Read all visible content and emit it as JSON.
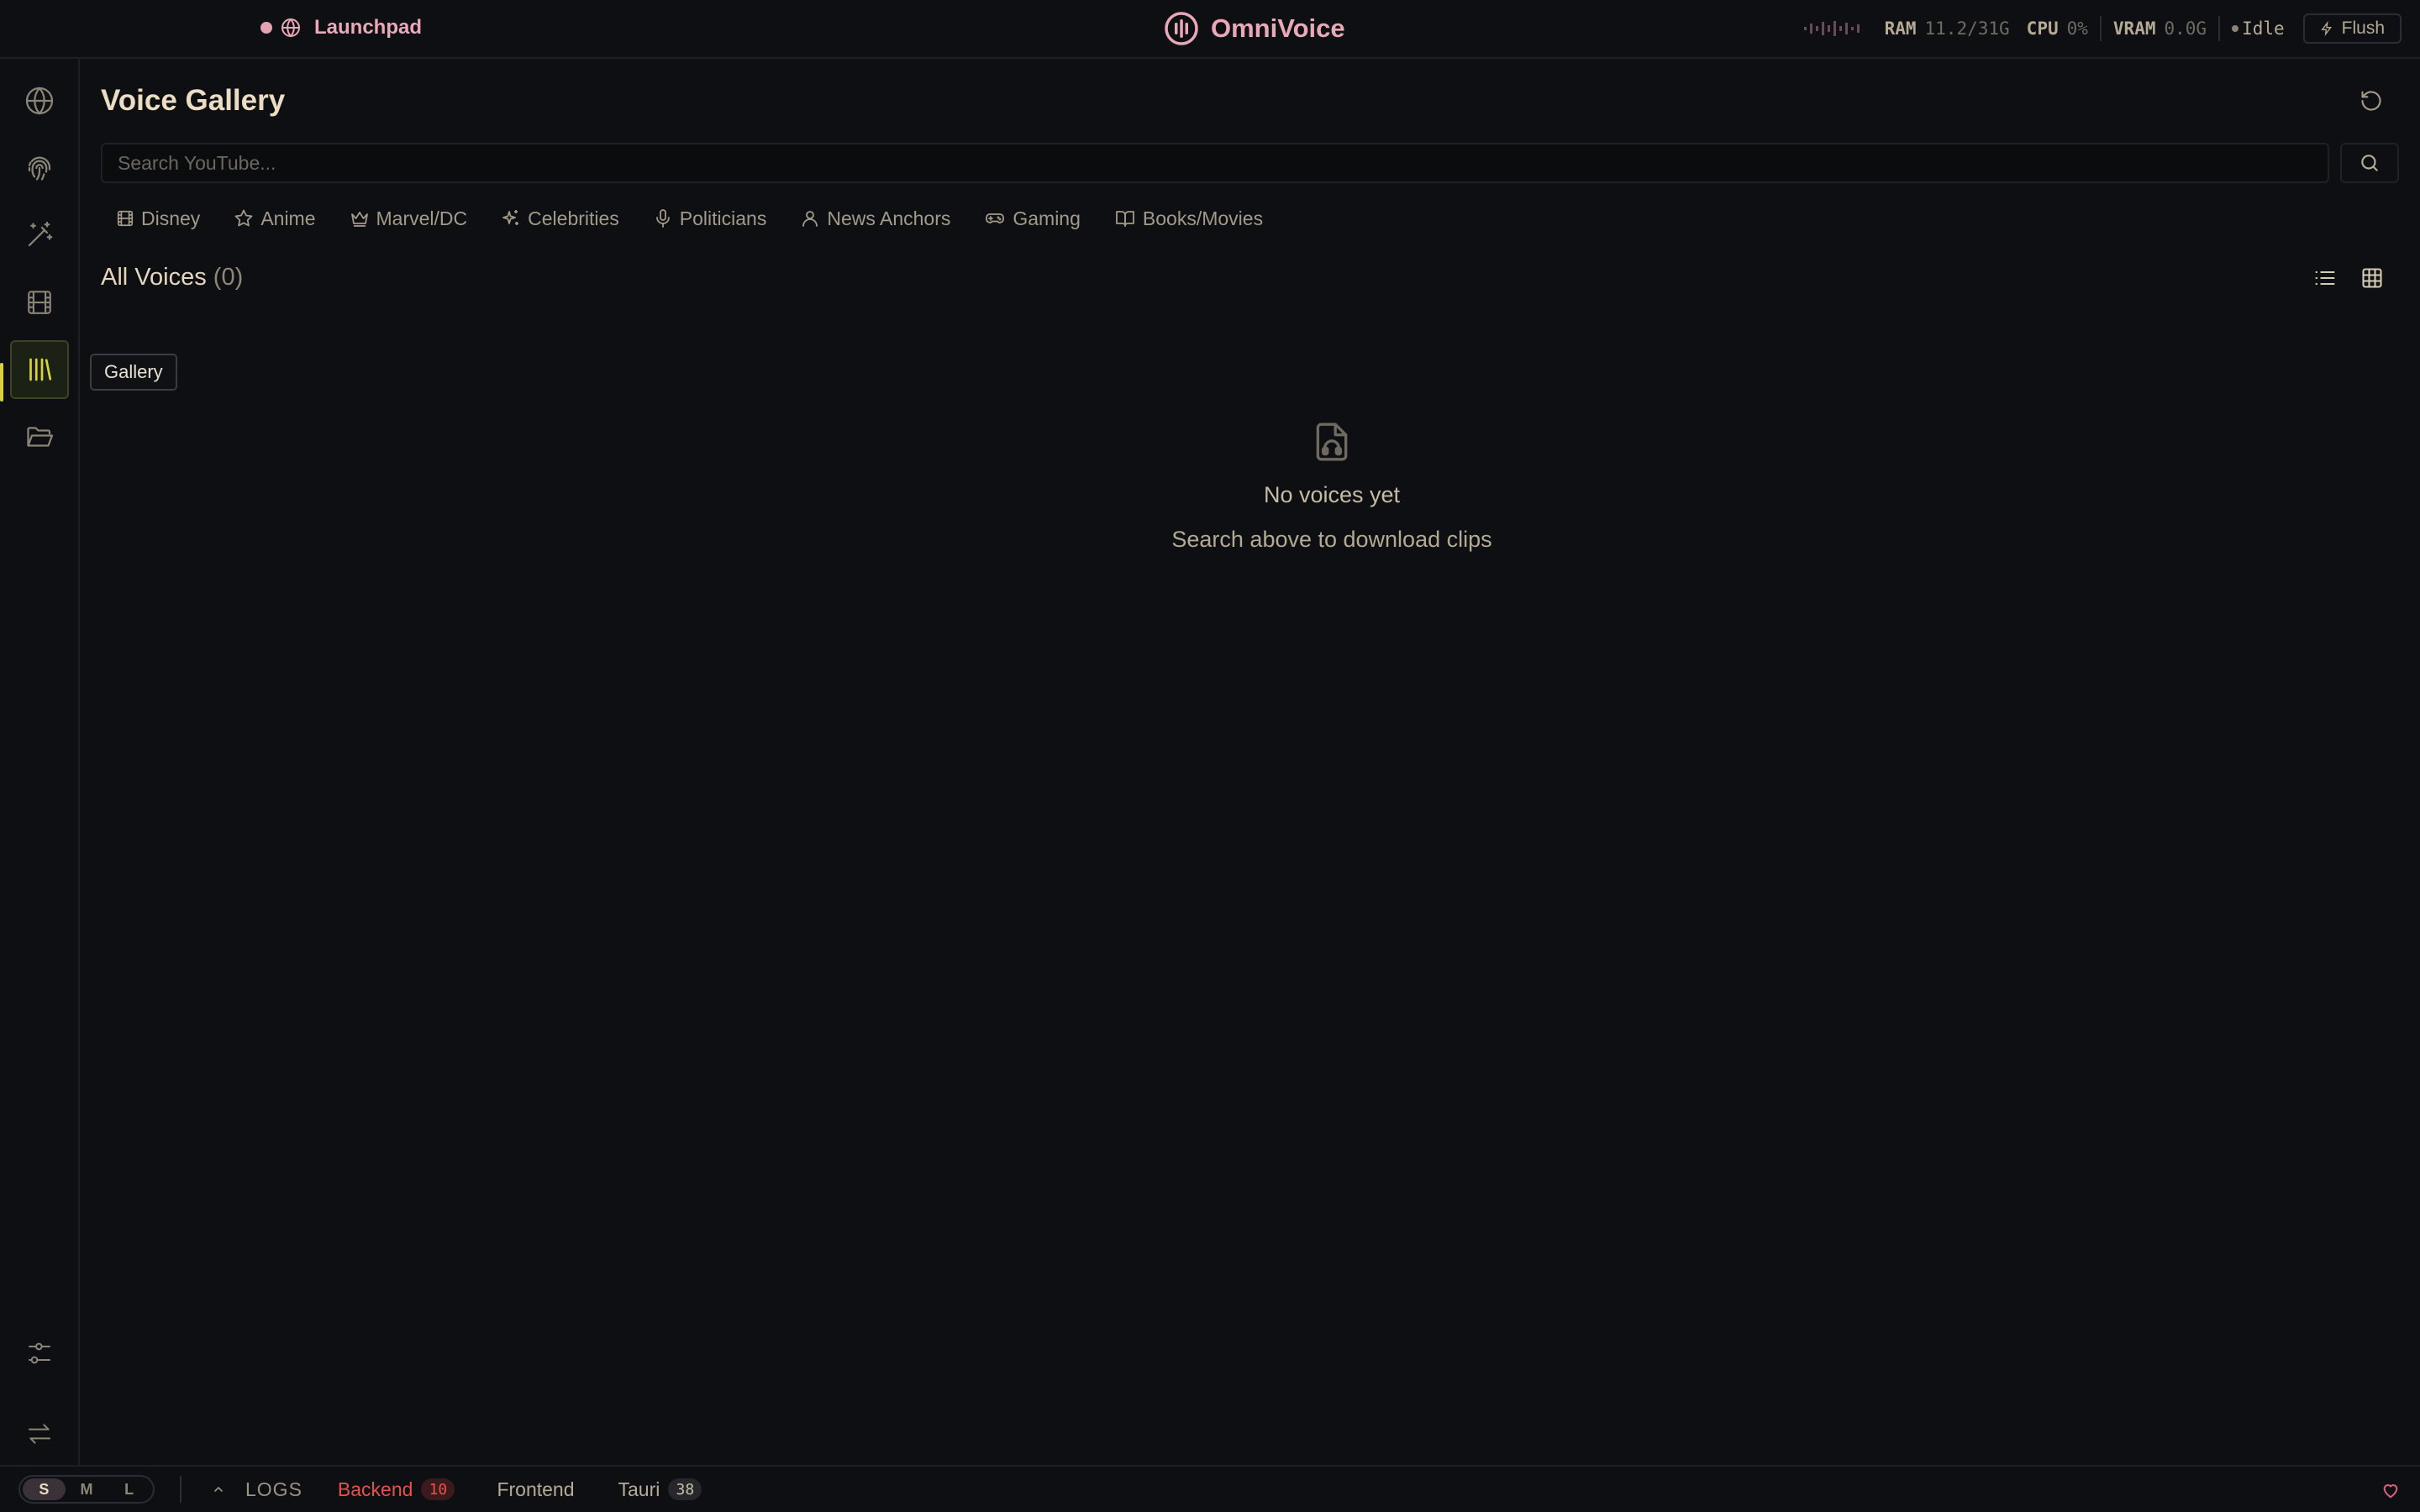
{
  "app": {
    "launchpad_label": "Launchpad",
    "brand_title": "OmniVoice"
  },
  "stats": {
    "ram_label": "RAM",
    "ram_value": "11.2/31G",
    "cpu_label": "CPU",
    "cpu_value": "0%",
    "vram_label": "VRAM",
    "vram_value": "0.0G",
    "status": "Idle",
    "flush_label": "Flush"
  },
  "sidebar": {
    "items": [
      {
        "name": "globe",
        "icon": "globe-icon"
      },
      {
        "name": "fingerprint",
        "icon": "fingerprint-icon"
      },
      {
        "name": "magic",
        "icon": "magic-wand-icon"
      },
      {
        "name": "film",
        "icon": "film-icon"
      },
      {
        "name": "gallery",
        "icon": "library-icon",
        "active": true
      },
      {
        "name": "folder",
        "icon": "folder-open-icon"
      }
    ],
    "bottom_items": [
      {
        "name": "settings",
        "icon": "sliders-icon"
      },
      {
        "name": "swap",
        "icon": "swap-icon"
      }
    ],
    "tooltip": "Gallery"
  },
  "main": {
    "title": "Voice Gallery",
    "search_placeholder": "Search YouTube...",
    "categories": [
      {
        "label": "Disney",
        "icon": "film-icon"
      },
      {
        "label": "Anime",
        "icon": "star-icon"
      },
      {
        "label": "Marvel/DC",
        "icon": "crown-icon"
      },
      {
        "label": "Celebrities",
        "icon": "sparkles-icon"
      },
      {
        "label": "Politicians",
        "icon": "mic-icon"
      },
      {
        "label": "News Anchors",
        "icon": "user-icon"
      },
      {
        "label": "Gaming",
        "icon": "gamepad-icon"
      },
      {
        "label": "Books/Movies",
        "icon": "book-open-icon"
      }
    ],
    "section_title": "All Voices",
    "section_count": "(0)",
    "empty_title": "No voices yet",
    "empty_subtitle": "Search above to download clips"
  },
  "bottombar": {
    "sizes": [
      "S",
      "M",
      "L"
    ],
    "active_size": "S",
    "logs_label": "LOGS",
    "tabs": [
      {
        "label": "Backend",
        "count": "10"
      },
      {
        "label": "Frontend",
        "count": ""
      },
      {
        "label": "Tauri",
        "count": "38"
      }
    ]
  },
  "colors": {
    "accent_pink": "#e9a8b7",
    "accent_yellow": "#d8d242",
    "error_red": "#e8514b",
    "background": "#0d0f12"
  }
}
